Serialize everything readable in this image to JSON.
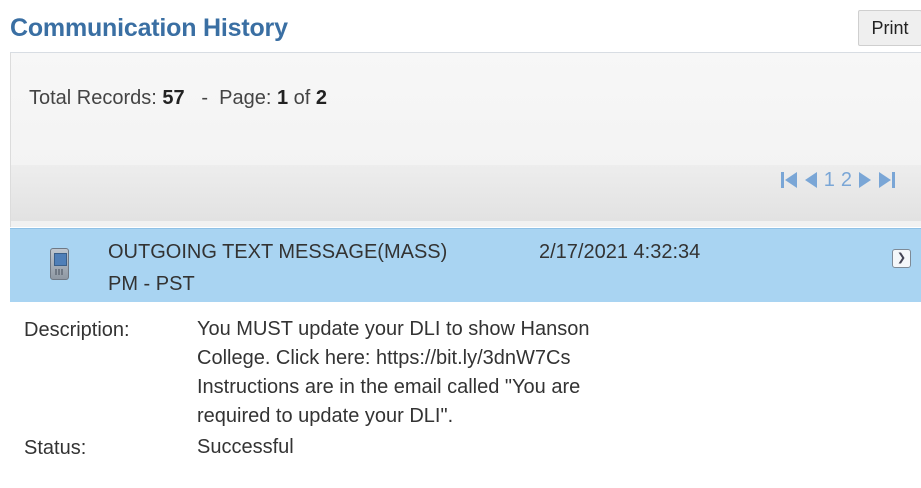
{
  "header": {
    "title": "Communication History",
    "print_label": "Print"
  },
  "records": {
    "total_label": "Total Records:",
    "total": "57",
    "separator": "-",
    "page_label": "Page:",
    "current_page": "1",
    "of_label": "of",
    "total_pages": "2"
  },
  "pager": {
    "pages": [
      "1",
      "2"
    ],
    "color": "#7aa6d6"
  },
  "message": {
    "type": "OUTGOING TEXT MESSAGE(MASS)",
    "date": "2/17/2021 4:32:34",
    "date_suffix": "PM - PST",
    "header_bg": "#a9d4f2",
    "description_label": "Description:",
    "description_lines": [
      "You MUST update your DLI to show Hanson",
      "College. Click here: https://bit.ly/3dnW7Cs",
      "Instructions are in the email called \"You are",
      "required to update your DLI\"."
    ],
    "status_label": "Status:",
    "status": "Successful"
  },
  "colors": {
    "title": "#3a6fa3",
    "accent": "#a9d4f2"
  }
}
